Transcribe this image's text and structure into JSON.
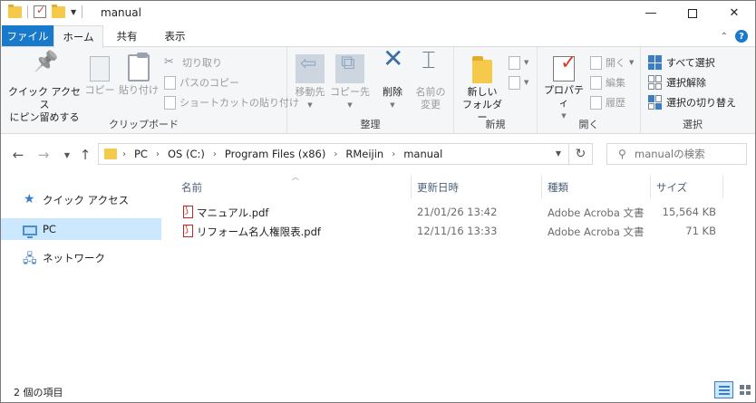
{
  "window": {
    "title": "manual",
    "controls": {
      "minimize": "—",
      "maximize": "",
      "close": "✕"
    }
  },
  "ribbon_tabs": [
    "ファイル",
    "ホーム",
    "共有",
    "表示"
  ],
  "ribbon": {
    "clipboard": {
      "label": "クリップボード",
      "pin": "クイック アクセス\nにピン留めする",
      "copy": "コピー",
      "paste": "貼り付け",
      "cut": "切り取り",
      "copy_path": "パスのコピー",
      "paste_shortcut": "ショートカットの貼り付け"
    },
    "organize": {
      "label": "整理",
      "move_to": "移動先",
      "copy_to": "コピー先",
      "delete": "削除",
      "rename": "名前の\n変更"
    },
    "new": {
      "label": "新規",
      "new_folder": "新しい\nフォルダー"
    },
    "open": {
      "label": "開く",
      "properties": "プロパティ",
      "open": "開く",
      "edit": "編集",
      "history": "履歴"
    },
    "select": {
      "label": "選択",
      "select_all": "すべて選択",
      "select_none": "選択解除",
      "invert": "選択の切り替え"
    }
  },
  "address": {
    "crumbs": [
      "PC",
      "OS (C:)",
      "Program Files (x86)",
      "RMeijin",
      "manual"
    ],
    "search_placeholder": "manualの検索"
  },
  "nav_pane": {
    "items": [
      {
        "label": "クイック アクセス",
        "icon": "star-icon"
      },
      {
        "label": "PC",
        "icon": "pc-icon",
        "selected": true
      },
      {
        "label": "ネットワーク",
        "icon": "network-icon"
      }
    ]
  },
  "columns": {
    "name": "名前",
    "date": "更新日時",
    "type": "種類",
    "size": "サイズ"
  },
  "files": [
    {
      "name": "マニュアル.pdf",
      "date": "21/01/26 13:42",
      "type": "Adobe Acroba 文書",
      "size": "15,564 KB"
    },
    {
      "name": "リフォーム名人権限表.pdf",
      "date": "12/11/16 13:33",
      "type": "Adobe Acroba 文書",
      "size": "71 KB"
    }
  ],
  "status": {
    "item_count": "2 個の項目"
  }
}
